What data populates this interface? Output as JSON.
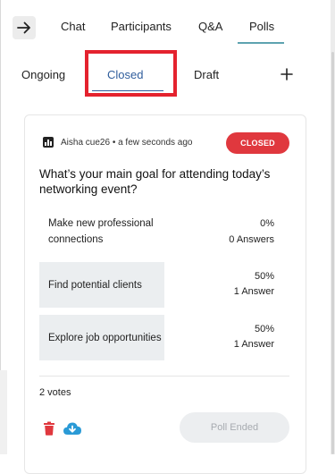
{
  "header": {
    "back_icon": "arrow-right-icon",
    "tabs": [
      "Chat",
      "Participants",
      "Q&A",
      "Polls"
    ],
    "active_tab": "Polls",
    "accent_color": "#5ea3b0"
  },
  "poll_tabs": {
    "items": [
      "Ongoing",
      "Closed",
      "Draft"
    ],
    "active": "Closed",
    "add_icon": "plus-icon",
    "highlight_color": "#e4222e"
  },
  "poll": {
    "author_line": "Aisha cue26 • a few seconds ago",
    "status": "CLOSED",
    "status_color": "#e0383e",
    "question": "What’s your main goal for attending today’s networking event?",
    "options": [
      {
        "label": "Make new professional connections",
        "percent": "0%",
        "answers": "0 Answers",
        "fraction": 0
      },
      {
        "label": "Find potential clients",
        "percent": "50%",
        "answers": "1 Answer",
        "fraction": 0.5
      },
      {
        "label": "Explore job opportunities",
        "percent": "50%",
        "answers": "1 Answer",
        "fraction": 0.5
      }
    ],
    "votes": "2 votes",
    "actions": {
      "delete_icon": "trash-icon",
      "download_icon": "cloud-download-icon"
    },
    "ended_label": "Poll Ended"
  }
}
